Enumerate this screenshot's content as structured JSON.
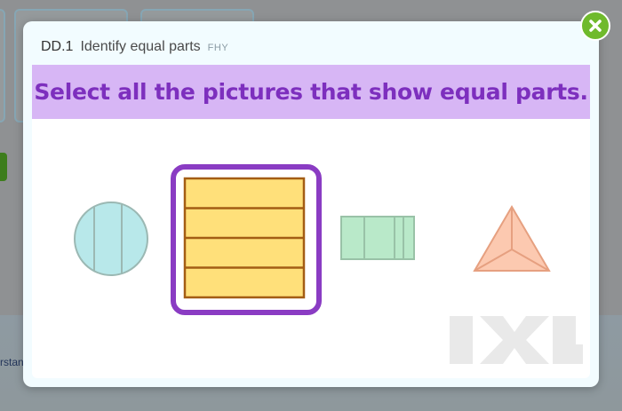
{
  "modal": {
    "skill_code": "DD.1",
    "skill_name": "Identify equal parts",
    "skill_tag": "FHY",
    "prompt": "Select all the pictures that show equal parts."
  },
  "background": {
    "link_text": "rstan"
  },
  "choices": [
    {
      "shape": "circle",
      "parts": 3,
      "equal": false,
      "selected": false,
      "fill": "#b8e8ea",
      "stroke": "#9bb8b3"
    },
    {
      "shape": "rectangle",
      "parts": 4,
      "equal": true,
      "selected": true,
      "fill": "#ffe07a",
      "stroke": "#a35d14"
    },
    {
      "shape": "rectangle",
      "parts": 4,
      "equal": false,
      "selected": false,
      "fill": "#b9e9c9",
      "stroke": "#99c2a7"
    },
    {
      "shape": "triangle",
      "parts": 3,
      "equal": true,
      "selected": false,
      "fill": "#fcc9b0",
      "stroke": "#e6a080"
    }
  ],
  "icons": {
    "close": "close-icon",
    "watermark": "ixl-logo"
  },
  "colors": {
    "prompt_bg": "#d7b6f5",
    "prompt_text": "#7d2fbe",
    "selected_border": "#8a3cc3",
    "close_bg": "#6fba2c"
  },
  "watermark_text": "IXL"
}
